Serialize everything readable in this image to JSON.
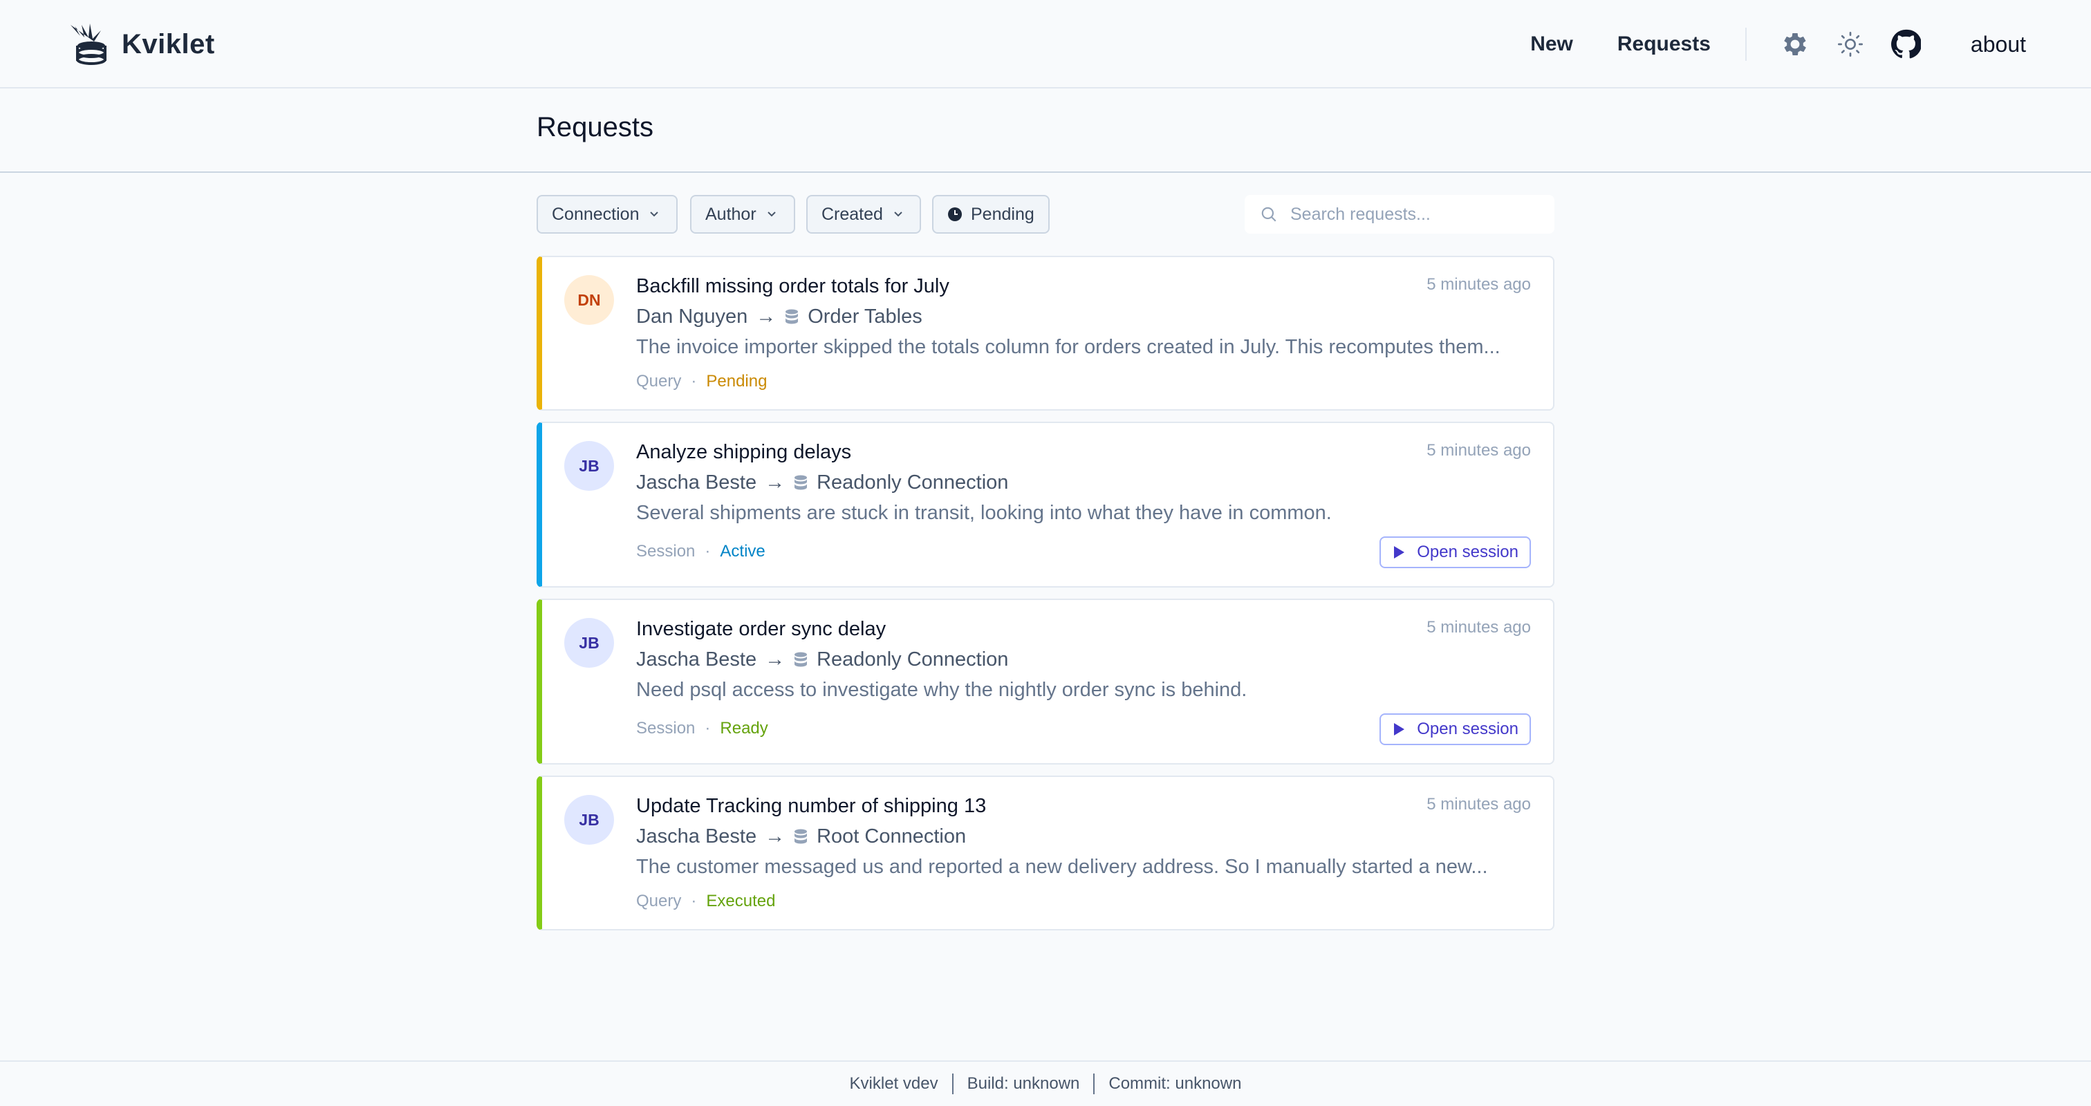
{
  "app": {
    "name": "Kviklet"
  },
  "nav": {
    "new": "New",
    "requests": "Requests",
    "about": "about",
    "icons": [
      "gear-icon",
      "sun-icon",
      "github-icon"
    ]
  },
  "page": {
    "title": "Requests"
  },
  "filters": {
    "connection": "Connection",
    "author": "Author",
    "created": "Created",
    "pending": "Pending",
    "search_placeholder": "Search requests..."
  },
  "requests": [
    {
      "initials": "DN",
      "title": "Backfill missing order totals for July",
      "time": "5 minutes ago",
      "author": "Dan Nguyen",
      "arrow": "→",
      "connection": "Order Tables",
      "description": "The invoice importer skipped the totals column for orders created in July. This recomputes them...",
      "type": "Query",
      "dot": "·",
      "status": "Pending",
      "accent": "#eab308",
      "status_color": "#ca8a04",
      "avatar_bg": "#ffedd5",
      "avatar_fg": "#c2410c"
    },
    {
      "initials": "JB",
      "title": "Analyze shipping delays",
      "time": "5 minutes ago",
      "author": "Jascha Beste",
      "arrow": "→",
      "connection": "Readonly Connection",
      "description": "Several shipments are stuck in transit, looking into what they have in common.",
      "type": "Session",
      "dot": "·",
      "status": "Active",
      "accent": "#0ea5e9",
      "status_color": "#0284c7",
      "avatar_bg": "#e0e7ff",
      "avatar_fg": "#3730a3",
      "action": "Open session"
    },
    {
      "initials": "JB",
      "title": "Investigate order sync delay",
      "time": "5 minutes ago",
      "author": "Jascha Beste",
      "arrow": "→",
      "connection": "Readonly Connection",
      "description": "Need psql access to investigate why the nightly order sync is behind.",
      "type": "Session",
      "dot": "·",
      "status": "Ready",
      "accent": "#84cc16",
      "status_color": "#65a30d",
      "avatar_bg": "#e0e7ff",
      "avatar_fg": "#3730a3",
      "action": "Open session"
    },
    {
      "initials": "JB",
      "title": "Update Tracking number of shipping 13",
      "time": "5 minutes ago",
      "author": "Jascha Beste",
      "arrow": "→",
      "connection": "Root Connection",
      "description": "The customer messaged us and reported a new delivery address. So I manually started a new...",
      "type": "Query",
      "dot": "·",
      "status": "Executed",
      "accent": "#84cc16",
      "status_color": "#65a30d",
      "avatar_bg": "#e0e7ff",
      "avatar_fg": "#3730a3"
    }
  ],
  "footer": {
    "version": "Kviklet vdev",
    "build": "Build: unknown",
    "commit": "Commit: unknown"
  }
}
